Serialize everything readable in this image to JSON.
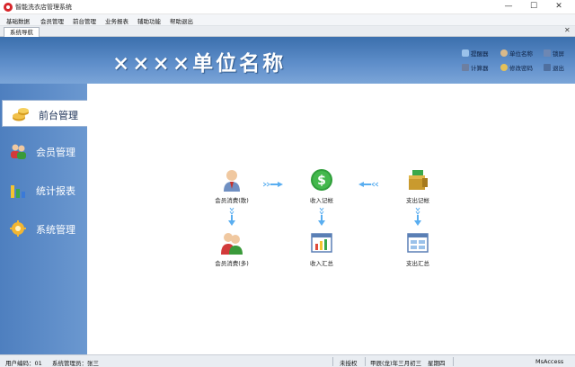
{
  "window": {
    "title": "智能洗衣店管理系统",
    "minimize": "—",
    "maximize": "☐",
    "close": "✕"
  },
  "menu": [
    "基础数据",
    "会员管理",
    "前台管理",
    "业务报表",
    "辅助功能",
    "帮助退出"
  ],
  "tab": {
    "label": "系统导航",
    "close": "✕"
  },
  "header": {
    "unit_name": "××××单位名称",
    "buttons": [
      {
        "label": "提醒器",
        "icon": "reminder-icon"
      },
      {
        "label": "单位名称",
        "icon": "person-icon"
      },
      {
        "label": "锁屏",
        "icon": "lock-icon"
      },
      {
        "label": "计算器",
        "icon": "calculator-icon"
      },
      {
        "label": "修改密码",
        "icon": "key-icon"
      },
      {
        "label": "退出",
        "icon": "exit-icon"
      }
    ]
  },
  "sidebar": {
    "items": [
      {
        "label": "前台管理",
        "icon": "coins-icon",
        "active": true
      },
      {
        "label": "会员管理",
        "icon": "members-icon",
        "active": false
      },
      {
        "label": "统计报表",
        "icon": "bar-chart-icon",
        "active": false
      },
      {
        "label": "系统管理",
        "icon": "gear-icon",
        "active": false
      }
    ]
  },
  "flow": {
    "nodes": [
      {
        "label": "会员消费(散)",
        "icon": "single-member-icon"
      },
      {
        "label": "收入记帐",
        "icon": "dollar-icon"
      },
      {
        "label": "支出记帐",
        "icon": "cash-box-icon"
      },
      {
        "label": "会员消费(多)",
        "icon": "multi-member-icon"
      },
      {
        "label": "收入汇总",
        "icon": "income-chart-icon"
      },
      {
        "label": "支出汇总",
        "icon": "expense-table-icon"
      }
    ]
  },
  "status": {
    "user_code": "用户编码：01",
    "admin": "系统管理员：张三",
    "license": "未授权",
    "lunar_date": "甲辰(龙)年三月初三",
    "weekday": "星期四",
    "database": "MsAccess"
  },
  "colors": {
    "header_top": "#3b6fad",
    "sidebar": "#5b8bc8",
    "flow_arrow": "#5aaef0"
  }
}
